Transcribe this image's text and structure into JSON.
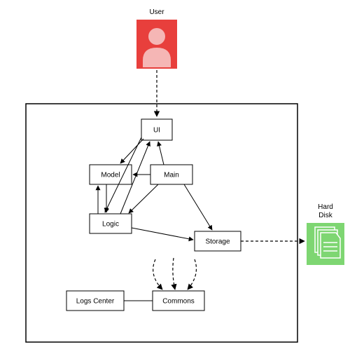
{
  "external": {
    "user_label": "User",
    "harddisk_label_line1": "Hard",
    "harddisk_label_line2": "Disk"
  },
  "nodes": {
    "ui": "UI",
    "main": "Main",
    "model": "Model",
    "logic": "Logic",
    "storage": "Storage",
    "commons": "Commons",
    "logs_center": "Logs Center"
  },
  "colors": {
    "user_bg": "#e83f3c",
    "user_fg": "#f5b6b5",
    "disk_bg": "#7ed672",
    "disk_fg": "#ffffff"
  }
}
